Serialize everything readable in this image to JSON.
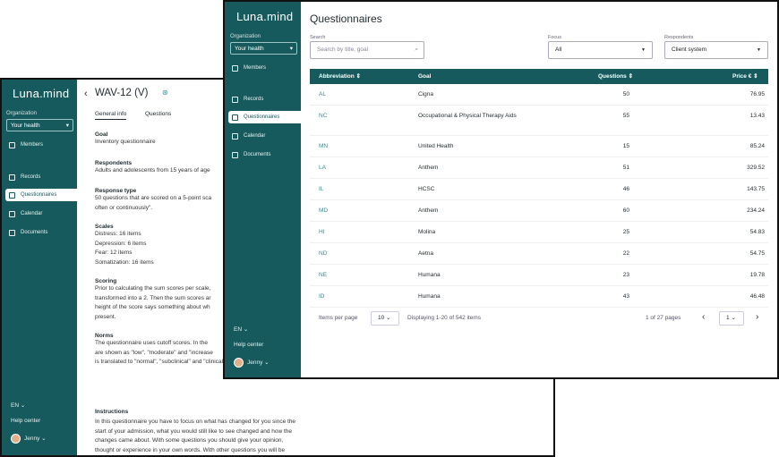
{
  "brand": {
    "logo": "Luna.mind",
    "accent": "#165a5d"
  },
  "org": {
    "label": "Organization",
    "value": "Your health"
  },
  "nav": {
    "members": "Members",
    "records": "Records",
    "questionnaires": "Questionnaires",
    "calendar": "Calendar",
    "documents": "Documents"
  },
  "sidebar_bottom": {
    "lang": "EN",
    "help": "Help center",
    "user": "Jenny"
  },
  "detail": {
    "title": "WAV-12 (V)",
    "tabs": [
      "General info",
      "Questions"
    ],
    "goal_h": "Goal",
    "goal": "Inventory questionnaire",
    "resp_h": "Respondents",
    "resp": "Adults and adolescents from 15 years of age",
    "rtype_h": "Response type",
    "rtype1": "50 questions that are scored on a 5-point sca",
    "rtype2": "often or continuously\".",
    "scales_h": "Scales",
    "scales": [
      "Distress: 16 items",
      "Depression: 6 items",
      "Fear: 12 items",
      "Somatization: 16 items"
    ],
    "scoring_h": "Scoring",
    "scoring": [
      "Prior to calculating the sum scores per scale,",
      "transformed into a 2. Then the sum scores ar",
      "height of the score says something about wh",
      "present."
    ],
    "norms_h": "Norms",
    "norms": [
      "The questionnaire uses cutoff scores. In the",
      "are shown as \"low\", \"moderate\" and \"increase",
      "is translated to \"normal\", \"subclinical\" and \"clinical\"."
    ],
    "instr_h": "Instructions",
    "instr": [
      "In this questionnaire you have to focus on what has changed for you since the",
      "start of your admission, what you would still like to see changed and how the",
      "changes came about. With some questions you should give your opinion,",
      "thought or experience in your own words. With other questions you will be"
    ]
  },
  "list": {
    "title": "Questionnaires",
    "search_label": "Search",
    "search_placeholder": "Search by title, goal",
    "focus_label": "Focus",
    "focus_value": "All",
    "resp_label": "Respondents",
    "resp_value": "Client system",
    "columns": [
      "Abbreviation",
      "Goal",
      "Questions",
      "Price €"
    ],
    "rows": [
      [
        "AL",
        "Cigna",
        "50",
        "76.95"
      ],
      [
        "NC",
        "Occupational & Physical Therapy Aids",
        "55",
        "13.43"
      ],
      [
        "MN",
        "United Health",
        "15",
        "85.24"
      ],
      [
        "LA",
        "Anthem",
        "51",
        "329.52"
      ],
      [
        "IL",
        "HCSC",
        "46",
        "143.75"
      ],
      [
        "MD",
        "Anthem",
        "60",
        "234.24"
      ],
      [
        "HI",
        "Molina",
        "25",
        "54.83"
      ],
      [
        "ND",
        "Aetna",
        "22",
        "54.75"
      ],
      [
        "NE",
        "Humana",
        "23",
        "19.78"
      ],
      [
        "ID",
        "Humana",
        "43",
        "46.48"
      ]
    ],
    "pager": {
      "per_page_label": "Items per page",
      "per_page": "10",
      "displaying": "Displaying 1-20 of 542 items",
      "page_of": "1 of 27 pages",
      "page": "1"
    }
  }
}
